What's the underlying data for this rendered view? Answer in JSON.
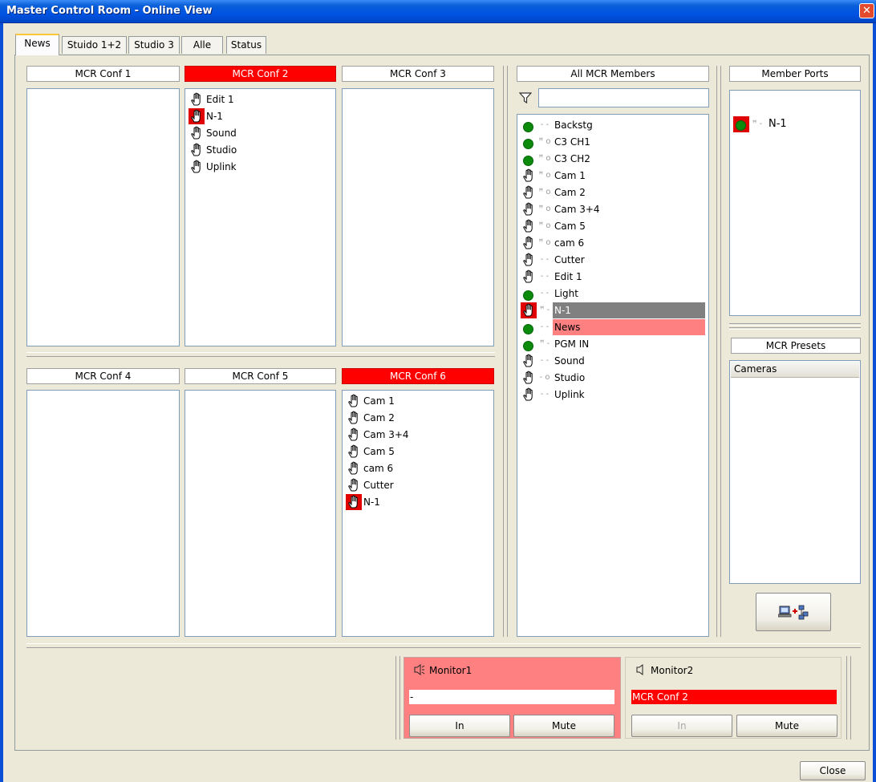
{
  "window": {
    "title": "Master Control Room - Online View",
    "close_glyph": "✕"
  },
  "tabs": [
    "News",
    "Stuido 1+2",
    "Studio 3",
    "Alle",
    "Status"
  ],
  "conferences": {
    "conf1": {
      "title": "MCR Conf 1",
      "items": []
    },
    "conf2": {
      "title": "MCR Conf 2",
      "items": [
        "Edit 1",
        "N-1",
        "Sound",
        "Studio",
        "Uplink"
      ]
    },
    "conf3": {
      "title": "MCR Conf 3",
      "items": []
    },
    "conf4": {
      "title": "MCR Conf 4",
      "items": []
    },
    "conf5": {
      "title": "MCR Conf 5",
      "items": []
    },
    "conf6": {
      "title": "MCR Conf 6",
      "items": [
        "Cam 1",
        "Cam 2",
        "Cam 3+4",
        "Cam 5",
        "cam 6",
        "Cutter",
        "N-1"
      ]
    }
  },
  "members": {
    "title": "All MCR Members",
    "filter_icon": "filter-icon",
    "filter_value": "",
    "items": [
      {
        "label": "Backstg",
        "marks": "- -"
      },
      {
        "label": "C3  CH1",
        "marks": "ꟸ o"
      },
      {
        "label": "C3  CH2",
        "marks": "ꟸ o"
      },
      {
        "label": "Cam 1",
        "marks": "ꟸ o"
      },
      {
        "label": "Cam 2",
        "marks": "ꟸ o"
      },
      {
        "label": "Cam 3+4",
        "marks": "ꟸ o"
      },
      {
        "label": "Cam 5",
        "marks": "ꟸ o"
      },
      {
        "label": "cam 6",
        "marks": "ꟸ o"
      },
      {
        "label": "Cutter",
        "marks": "- -"
      },
      {
        "label": "Edit 1",
        "marks": "- -"
      },
      {
        "label": "Light",
        "marks": "- -"
      },
      {
        "label": "N-1",
        "marks": "ꟸ -"
      },
      {
        "label": "News",
        "marks": "- -"
      },
      {
        "label": "PGM IN",
        "marks": "ꟸ -"
      },
      {
        "label": "Sound",
        "marks": "- -"
      },
      {
        "label": "Studio",
        "marks": "- o"
      },
      {
        "label": "Uplink",
        "marks": "- -"
      }
    ]
  },
  "member_ports": {
    "title": "Member Ports",
    "items": [
      {
        "label": "N-1",
        "marks": "ꟸ -"
      }
    ]
  },
  "presets": {
    "title": "MCR Presets",
    "column_header": "Cameras",
    "add_button_icon": "add-preset-icon"
  },
  "monitors": {
    "monitor1": {
      "label": "Monitor1",
      "value": "-",
      "in_label": "In",
      "mute_label": "Mute"
    },
    "monitor2": {
      "label": "Monitor2",
      "value": "MCR Conf 2",
      "in_label": "In",
      "mute_label": "Mute"
    }
  },
  "footer": {
    "close_label": "Close"
  },
  "colors": {
    "active_red": "#FF0000",
    "selection_pink": "#FF8080",
    "selection_gray": "#808080",
    "status_green": "#0B8A0B"
  }
}
